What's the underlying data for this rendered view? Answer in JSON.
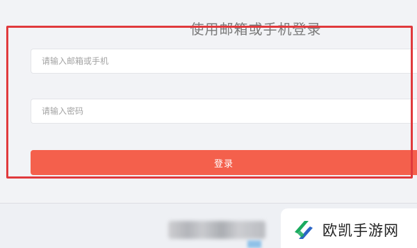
{
  "login": {
    "title": "使用邮箱或手机登录",
    "email_placeholder": "请输入邮箱或手机",
    "password_placeholder": "请输入密码",
    "submit_label": "登录"
  },
  "watermark": {
    "brand_text": "欧凯手游网",
    "icon": "brand-logo-icon"
  },
  "colors": {
    "highlight_border": "#e0393c",
    "button_bg": "#f4604c",
    "button_text": "#ffffff",
    "watermark_icon_green": "#1aab5f",
    "watermark_icon_blue": "#2b66c6"
  }
}
